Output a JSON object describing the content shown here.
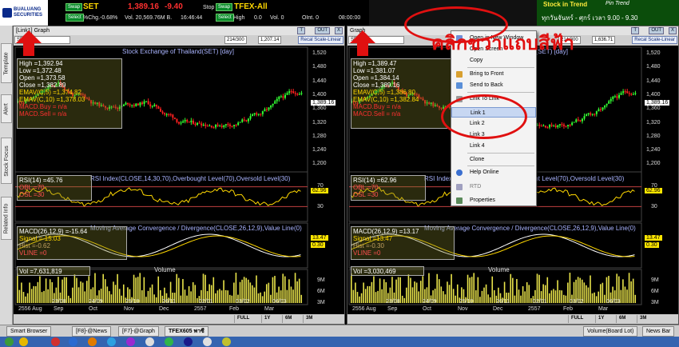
{
  "ticker": {
    "broker_top": "BUALUANG",
    "broker_bottom": "SECURITIES",
    "select_label": "Select",
    "swap_label": "Swap",
    "symbol": "SET",
    "last": "1,389.16",
    "change": "-9.40",
    "pct_change": "%Chg.-0.68%",
    "volume": "Vol. 20,569.76M B.",
    "time": "16:46:44",
    "stop_label": "Stop",
    "tfex_label": "TFEX-All",
    "tfex_high": "High",
    "tfex_vol": "Vol. 0",
    "tfex_oint": "OInt. 0",
    "tfex_time": "08:00:00",
    "tfex_zero": "0.0"
  },
  "ad": {
    "line1": "Stock in Trend",
    "brand": "Pin Trend",
    "line2": "ทุกวันจันทร์ - ศุกร์ เวลา 9.00 - 9.30"
  },
  "left_tabs": [
    "Template",
    "Alert",
    "Stock Focus",
    "Related Info"
  ],
  "windows": [
    {
      "title": "[Link1] Graph",
      "btn_t": "T",
      "btn_out": "OUT",
      "btn_x": "X",
      "symbol": "SET",
      "count": "214/300",
      "value": "1,207.14",
      "rescale": "Recal Scale-Linear",
      "chart_title": "Stock Exchange of Thailand(SET) [day]",
      "info": [
        "High  =1,392.94",
        "Low   =1,372.48",
        "Open  =1,373.58",
        "Close =1,382.89",
        "EMAV(C,5)  =1,374.82",
        "EMAV(C,10) =1,378.03",
        "MACD.Buy  = n/a",
        "MACD.Sell = n/a"
      ],
      "rsi_title": "RSI Index(CLOSE,14,30,70),Overbought Level(70),Oversold Level(30)",
      "rsi_info": [
        "RSI(14)  =45.76",
        "OBL   =70",
        "OSL   =30"
      ],
      "macd_title": "Moving Average Convergence / Divergence(CLOSE,26,12,9),Value Line(0)",
      "macd_info": [
        "MACD(26,12,9)  =-15.64",
        "Signal =-15.03",
        "Hist   =-0.62",
        "VLINE  =0"
      ],
      "vol_title": "Volume",
      "vol_info": "Vol  =7,631,819",
      "price_tag": "1,389.16",
      "rsi_tag": "62.96",
      "macd_tag": "13.47",
      "hist_tag": "0.30",
      "yaxis_price": [
        "1,520",
        "1,480",
        "1,440",
        "1,400",
        "1,360",
        "1,320",
        "1,280",
        "1,240",
        "1,200"
      ],
      "yaxis_rsi": [
        "70",
        "30"
      ],
      "yaxis_vol": [
        "9M",
        "6M",
        "3M"
      ],
      "xdates": [
        "23/08",
        "24/09",
        "25/10",
        "26/11",
        "02/01",
        "03/02",
        "06/03"
      ],
      "xmonths": [
        "2556 Aug",
        "Sep",
        "Oct",
        "Nov",
        "Dec",
        "2557",
        "Feb",
        "Mar"
      ],
      "foot": [
        "FULL",
        "1Y",
        "6M",
        "3M"
      ]
    },
    {
      "title": "Graph",
      "btn_t": "T",
      "btn_out": "OUT",
      "btn_x": "X",
      "symbol": "SET",
      "count": "214/300",
      "value": "1,636.71",
      "rescale": "Recal Scale-Linear",
      "chart_title": "Stock Exchange of Thailand(SET) [day]",
      "info": [
        "High  =1,389.47",
        "Low   =1,381.07",
        "Open  =1,384.14",
        "Close =1,389.16",
        "EMAV(C,5)  =1,386.80",
        "EMAV(C,10) =1,382.84",
        "MACD.Buy  = n/a",
        "MACD.Sell = n/a"
      ],
      "rsi_title": "RSI Index(CLOSE,14,30,70),Overbought Level(70),Oversold Level(30)",
      "rsi_info": [
        "RSI(14)  =62.96",
        "OBL   =70",
        "OSL   =30"
      ],
      "macd_title": "Moving Average Convergence / Divergence(CLOSE,26,12,9),Value Line(0)",
      "macd_info": [
        "MACD(26,12,9)  =13.17",
        "Signal =13.47",
        "Hist   =-0.30",
        "VLINE  =0"
      ],
      "vol_title": "Volume",
      "vol_info": "Vol  =3,030,469",
      "price_tag": "1,389.16",
      "rsi_tag": "62.96",
      "macd_tag": "13.47",
      "hist_tag": "0.30",
      "yaxis_price": [
        "1,520",
        "1,480",
        "1,440",
        "1,400",
        "1,360",
        "1,320",
        "1,280",
        "1,240",
        "1,200"
      ],
      "yaxis_rsi": [
        "70",
        "30"
      ],
      "yaxis_vol": [
        "9M",
        "6M",
        "3M"
      ],
      "xdates": [
        "23/08",
        "24/09",
        "25/10",
        "26/11",
        "02/01",
        "03/02",
        "06/03"
      ],
      "xmonths": [
        "2556 Aug",
        "Sep",
        "Oct",
        "Nov",
        "Dec",
        "2557",
        "Feb",
        "Mar"
      ],
      "foot": [
        "FULL",
        "1Y",
        "6M",
        "3M"
      ]
    }
  ],
  "context_menu": {
    "items": [
      "Open in New Window",
      "Open Screen",
      "Copy",
      "Bring to Front",
      "Send to Back",
      "Link To Link",
      "Link 1",
      "Link 2",
      "Link 3",
      "Link 4",
      "Clone",
      "Help Online",
      "RTD",
      "Properties"
    ]
  },
  "annotation": "คลิกขวาแถบสีฟ้า",
  "bottom_tabs": [
    "Smart Browser",
    "[F8]-@News",
    "[F7]-@Graph",
    "TFEX605 พาซี",
    "Volume(Board Lot)",
    "News Bar"
  ],
  "colors": {
    "bull": "#33ff33",
    "bear": "#ff2020",
    "annotation": "#e01010",
    "menu_highlight": "#c7d7f2"
  }
}
